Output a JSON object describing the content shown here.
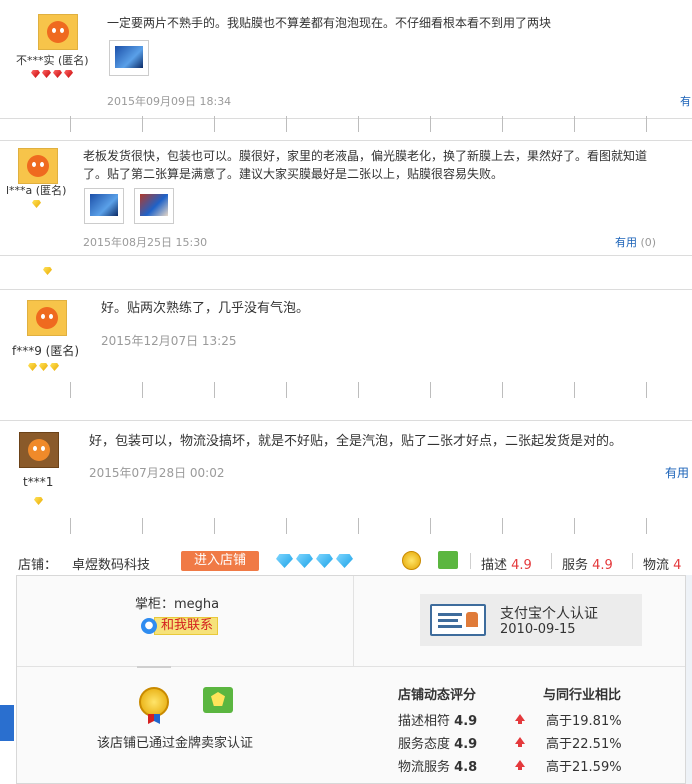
{
  "reviews": [
    {
      "user": "不***实 (匿名)",
      "text": "一定要两片不熟手的。我贴膜也不算差都有泡泡现在。不仔细看根本看不到用了两块",
      "date": "2015年09月09日 18:34",
      "rank_gems": 4,
      "rank_color": "red",
      "useful": "有"
    },
    {
      "user": "l***a (匿名)",
      "text": "老板发货很快，包装也可以。膜很好，家里的老液晶，偏光膜老化，换了新膜上去，果然好了。看图就知道了。贴了第二张算是满意了。建议大家买膜最好是二张以上，贴膜很容易失败。",
      "date": "2015年08月25日 15:30",
      "rank_gems": 1,
      "rank_color": "gold",
      "useful_label": "有用",
      "useful_count": "(0)"
    },
    {
      "user": "f***9 (匿名)",
      "text": "好。贴两次熟练了，几乎没有气泡。",
      "date": "2015年12月07日 13:25",
      "rank_gems": 3,
      "rank_color": "gold"
    },
    {
      "user": "t***1",
      "text": "好，包装可以，物流没搞坏，就是不好贴，全是汽泡，贴了二张才好点，二张起发货是对的。",
      "date": "2015年07月28日 00:02",
      "rank_gems": 1,
      "rank_color": "gold",
      "useful_label": "有用"
    }
  ],
  "shop": {
    "label": "店铺：",
    "name": "卓煜数码科技",
    "enter_button": "进入店铺",
    "seller_gems": 4,
    "scores": [
      {
        "name": "描述",
        "value": "4.9"
      },
      {
        "name": "服务",
        "value": "4.9"
      },
      {
        "name": "物流",
        "value": "4"
      }
    ]
  },
  "panel": {
    "keeper": "掌柜：megha",
    "contact_badge": "●",
    "contact_label": "和我联系",
    "alipay_title": "支付宝个人认证",
    "alipay_date": "2010-09-15",
    "cert_text": "该店铺已通过金牌卖家认证",
    "dsr_header": "店铺动态评分",
    "compare_header": "与同行业相比",
    "dsr": [
      {
        "name": "描述相符",
        "score": "4.9",
        "compare": "高于19.81%"
      },
      {
        "name": "服务态度",
        "score": "4.9",
        "compare": "高于22.51%"
      },
      {
        "name": "物流服务",
        "score": "4.8",
        "compare": "高于21.59%"
      }
    ]
  },
  "colors": {
    "accent_red": "#e4393c",
    "link_blue": "#1a62b8",
    "enter_button": "#f07a46"
  }
}
